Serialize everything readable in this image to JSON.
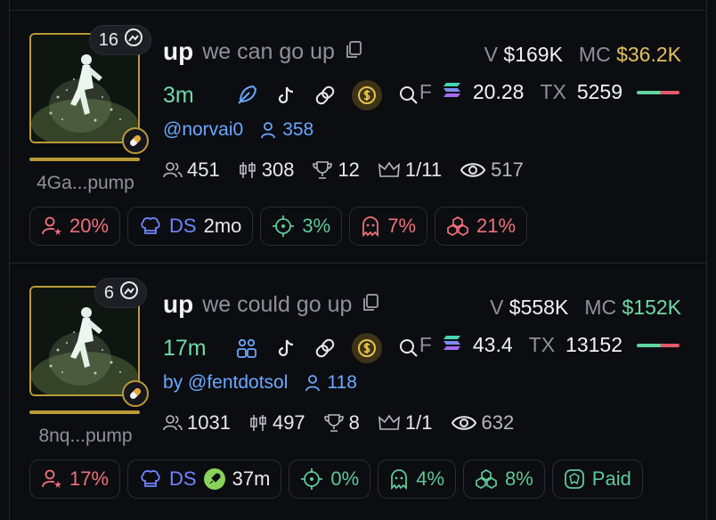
{
  "cards": [
    {
      "badge_count": "16",
      "address": "4Ga...pump",
      "symbol": "up",
      "name": "we can go up",
      "volume_label": "V",
      "volume": "$169K",
      "mcap_label": "MC",
      "mcap": "$36.2K",
      "mcap_color": "#e2c15b",
      "age": "3m",
      "fee_label": "F",
      "fee": "20.28",
      "tx_label": "TX",
      "tx": "5259",
      "dev": "@norvai0",
      "followers": "358",
      "holders": "451",
      "candles": "308",
      "trophy": "12",
      "crown": "1/11",
      "views": "517",
      "chips": {
        "top10": "20%",
        "dev_label": "DS",
        "dev_age": "2mo",
        "snipers": "3%",
        "insiders": "7%",
        "bundle": "21%"
      }
    },
    {
      "badge_count": "6",
      "address": "8nq...pump",
      "symbol": "up",
      "name": "we could go up",
      "volume_label": "V",
      "volume": "$558K",
      "mcap_label": "MC",
      "mcap": "$152K",
      "mcap_color": "#6fd9a8",
      "age": "17m",
      "fee_label": "F",
      "fee": "43.4",
      "tx_label": "TX",
      "tx": "13152",
      "dev": "by @fentdotsol",
      "followers": "118",
      "holders": "1031",
      "candles": "497",
      "trophy": "8",
      "crown": "1/1",
      "views": "632",
      "chips": {
        "top10": "17%",
        "dev_label": "DS",
        "dev_age": "37m",
        "snipers": "0%",
        "insiders": "4%",
        "bundle": "8%",
        "paid": "Paid"
      }
    }
  ],
  "icons": [
    "picture-icon",
    "pill-icon",
    "copy-icon",
    "feather-icon",
    "tiktok-icon",
    "link-icon",
    "coin-icon",
    "search-icon",
    "solana-icon",
    "user-icon",
    "users-icon",
    "candle-icon",
    "trophy-icon",
    "crown-icon",
    "eye-icon",
    "user-star-icon",
    "chef-hat-icon",
    "crosshair-icon",
    "ghost-icon",
    "bundle-icon",
    "rocket-icon",
    "dex-paid-icon",
    "community-icon"
  ]
}
